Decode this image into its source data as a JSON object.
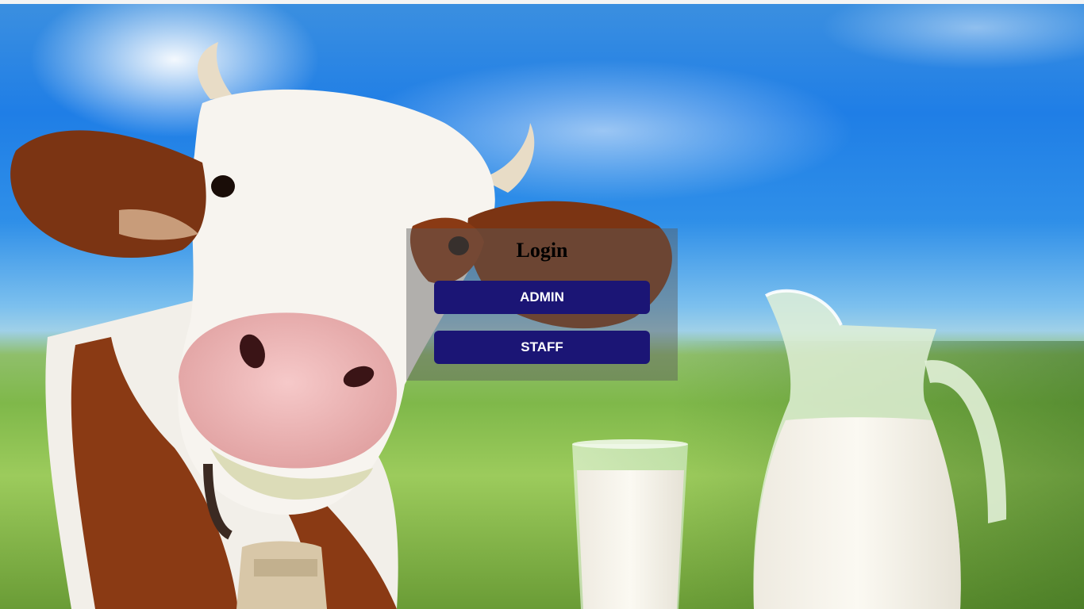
{
  "login": {
    "title": "Login",
    "buttons": {
      "admin_label": "ADMIN",
      "staff_label": "STAFF"
    }
  },
  "colors": {
    "button_background": "#1b1575",
    "button_text": "#ffffff",
    "panel_overlay": "rgba(90,90,90,0.45)",
    "title_text": "#000000"
  },
  "background": {
    "icon": "cow-and-milk-photo"
  }
}
